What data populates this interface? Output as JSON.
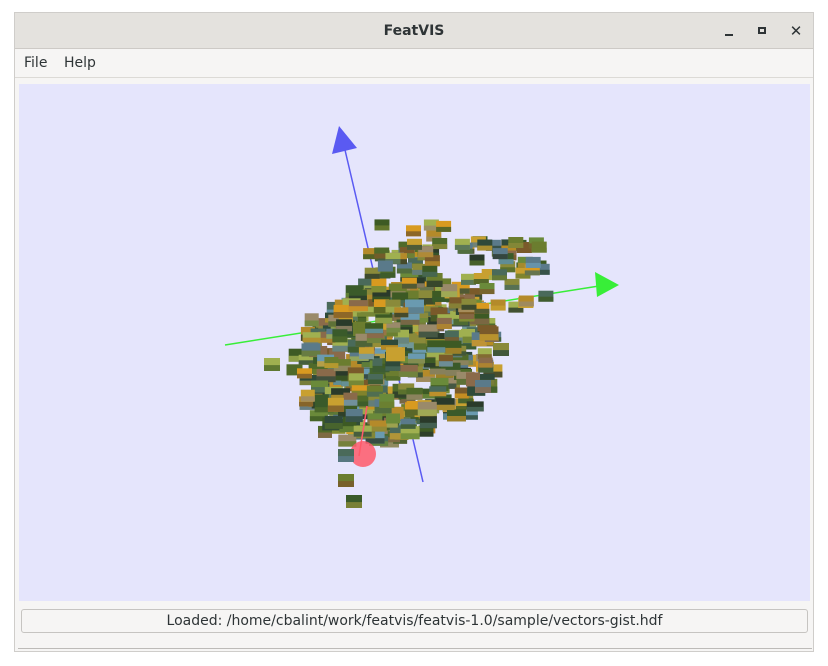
{
  "window": {
    "title": "FeatVIS",
    "minimize_icon": "minimize-icon",
    "maximize_icon": "maximize-icon",
    "close_icon": "close-icon",
    "close_glyph": "✕"
  },
  "menu": {
    "items": [
      {
        "label": "File"
      },
      {
        "label": "Help"
      }
    ]
  },
  "viewport": {
    "background": "#e5e5fc",
    "axes": {
      "x_color": "#ff5a6a",
      "y_color": "#38ee38",
      "z_color": "#5a5af2"
    },
    "palette": [
      "#4f6a2a",
      "#6b7d2f",
      "#3d5a24",
      "#8a8a3a",
      "#b48a2a",
      "#d89a20",
      "#7a5a2a",
      "#2f4a3a",
      "#5a7a8a",
      "#9a8a6a",
      "#3a5a2a",
      "#6a8a3a",
      "#c8a030",
      "#4a6a5a",
      "#8a6a4a",
      "#2a3a2a",
      "#a0b050",
      "#6a9ab0"
    ]
  },
  "status": {
    "text": "Loaded: /home/cbalint/work/featvis/featvis-1.0/sample/vectors-gist.hdf"
  }
}
